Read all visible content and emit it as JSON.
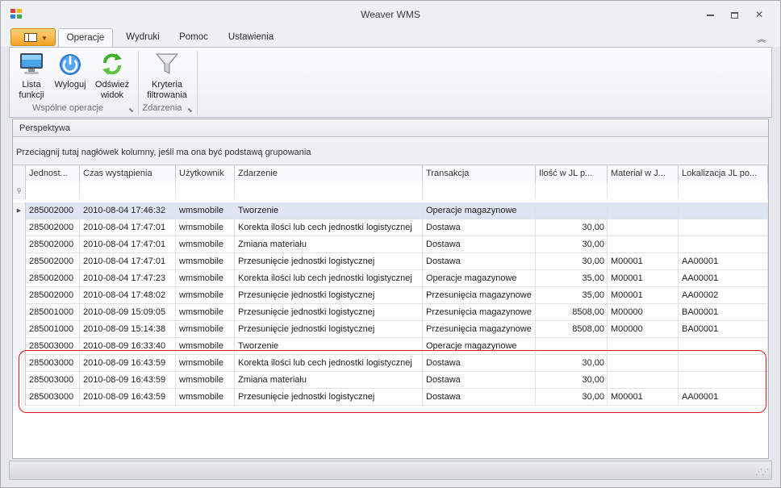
{
  "window": {
    "title": "Weaver WMS",
    "minimize": "▭",
    "restore": "▣",
    "close": "✕"
  },
  "tabs": [
    {
      "label": "Operacje",
      "active": true
    },
    {
      "label": "Wydruki",
      "active": false
    },
    {
      "label": "Pomoc",
      "active": false
    },
    {
      "label": "Ustawienia",
      "active": false
    }
  ],
  "ribbon": {
    "buttons": [
      {
        "label1": "Lista",
        "label2": "funkcji",
        "icon": "monitor-icon"
      },
      {
        "label1": "Wyloguj",
        "label2": "",
        "icon": "power-icon"
      },
      {
        "label1": "Odśwież",
        "label2": "widok",
        "icon": "refresh-icon"
      },
      {
        "label1": "Kryteria",
        "label2": "filtrowania",
        "icon": "filter-icon"
      }
    ],
    "groups": [
      "Wspólne operacje",
      "Zdarzenia"
    ]
  },
  "panel": {
    "title": "Perspektywa",
    "group_hint": "Przeciągnij tutaj nagłówek kolumny, jeśli ma ona być podstawą grupowania"
  },
  "grid": {
    "columns": [
      "Jednost...",
      "Czas wystąpienia",
      "Użytkownik",
      "Zdarzenie",
      "Transakcja",
      "Ilość w JL p...",
      "Materiał w J...",
      "Lokalizacja JL po..."
    ],
    "rows": [
      [
        "285002000",
        "2010-08-04 17:46:32",
        "wmsmobile",
        "Tworzenie",
        "Operacje magazynowe",
        "",
        "",
        ""
      ],
      [
        "285002000",
        "2010-08-04 17:47:01",
        "wmsmobile",
        "Korekta ilości lub cech jednostki logistycznej",
        "Dostawa",
        "30,00",
        "",
        ""
      ],
      [
        "285002000",
        "2010-08-04 17:47:01",
        "wmsmobile",
        "Zmiana materiału",
        "Dostawa",
        "30,00",
        "",
        ""
      ],
      [
        "285002000",
        "2010-08-04 17:47:01",
        "wmsmobile",
        "Przesunięcie jednostki logistycznej",
        "Dostawa",
        "30,00",
        "M00001",
        "AA00001"
      ],
      [
        "285002000",
        "2010-08-04 17:47:23",
        "wmsmobile",
        "Korekta ilości lub cech jednostki logistycznej",
        "Operacje magazynowe",
        "35,00",
        "M00001",
        "AA00001"
      ],
      [
        "285002000",
        "2010-08-04 17:48:02",
        "wmsmobile",
        "Przesunięcie jednostki logistycznej",
        "Przesunięcia magazynowe",
        "35,00",
        "M00001",
        "AA00002"
      ],
      [
        "285001000",
        "2010-08-09 15:09:05",
        "wmsmobile",
        "Przesunięcie jednostki logistycznej",
        "Przesunięcia magazynowe",
        "8508,00",
        "M00000",
        "BA00001"
      ],
      [
        "285001000",
        "2010-08-09 15:14:38",
        "wmsmobile",
        "Przesunięcie jednostki logistycznej",
        "Przesunięcia magazynowe",
        "8508,00",
        "M00000",
        "BA00001"
      ],
      [
        "285003000",
        "2010-08-09 16:33:40",
        "wmsmobile",
        "Tworzenie",
        "Operacje magazynowe",
        "",
        "",
        ""
      ],
      [
        "285003000",
        "2010-08-09 16:43:59",
        "wmsmobile",
        "Korekta ilości lub cech jednostki logistycznej",
        "Dostawa",
        "30,00",
        "",
        ""
      ],
      [
        "285003000",
        "2010-08-09 16:43:59",
        "wmsmobile",
        "Zmiana materiału",
        "Dostawa",
        "30,00",
        "",
        ""
      ],
      [
        "285003000",
        "2010-08-09 16:43:59",
        "wmsmobile",
        "Przesunięcie jednostki logistycznej",
        "Dostawa",
        "30,00",
        "M00001",
        "AA00001"
      ]
    ],
    "selected_row": 0,
    "highlighted_rows": [
      9,
      10,
      11
    ]
  },
  "colors": {
    "accent": "#f2a126",
    "selection": "#dde6f2",
    "highlight": "#d71e1e"
  }
}
